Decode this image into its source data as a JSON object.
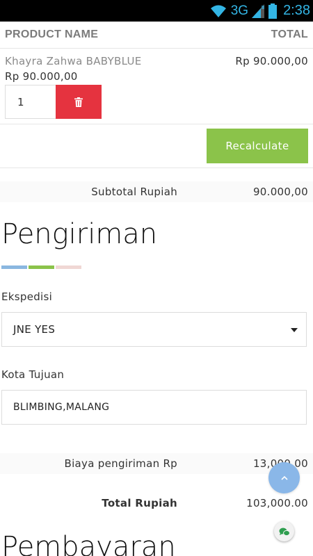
{
  "status_bar": {
    "network": "3G",
    "time": "2:38",
    "icons": [
      "wifi-icon",
      "signal-icon",
      "battery-icon"
    ]
  },
  "cart": {
    "col_product": "PRODUCT NAME",
    "col_total": "TOTAL",
    "items": [
      {
        "name": "Khayra Zahwa BABYBLUE",
        "price": "Rp 90.000,00",
        "total": "Rp 90.000,00",
        "quantity": "1"
      }
    ],
    "delete_icon": "trash-icon",
    "recalculate_label": "Recalculate",
    "subtotal_label": "Subtotal Rupiah",
    "subtotal_value": "90.000,00"
  },
  "shipping": {
    "title": "Pengiriman",
    "accent_colors": [
      "#8ab7e0",
      "#8bc34a",
      "#f0d7d4"
    ],
    "courier_label": "Ekspedisi",
    "courier_selected": "JNE YES",
    "city_label": "Kota Tujuan",
    "city_value": "BLIMBING,MALANG",
    "cost_label": "Biaya pengiriman  Rp",
    "cost_value": "13,000.00",
    "total_label": "Total Rupiah",
    "total_value": "103,000.00"
  },
  "payment": {
    "title": "Pembayaran"
  },
  "floating": {
    "scroll_top_icon": "chevron-up-icon",
    "chat_icon": "chat-icon"
  },
  "colors": {
    "delete": "#e5333f",
    "recalculate": "#8bc34a",
    "fab": "#8ab7e8",
    "status_icons": "#33b5e5"
  }
}
